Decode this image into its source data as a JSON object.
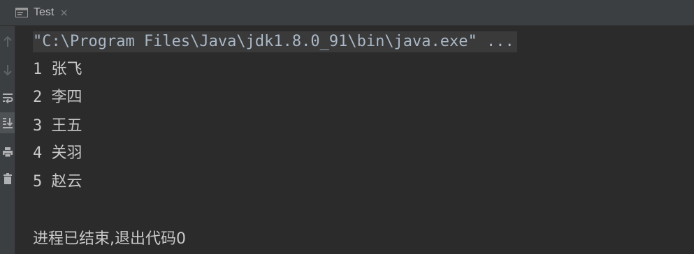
{
  "tab": {
    "title": "Test",
    "icon": "console-icon",
    "close": "×"
  },
  "toolbar": {
    "buttons": [
      {
        "name": "up-arrow-icon",
        "label": "↑"
      },
      {
        "name": "down-arrow-icon",
        "label": "↓"
      },
      {
        "name": "soft-wrap-icon",
        "label": "wrap"
      },
      {
        "name": "scroll-to-end-icon",
        "label": "scroll-end"
      },
      {
        "name": "print-icon",
        "label": "print"
      },
      {
        "name": "trash-icon",
        "label": "clear"
      }
    ]
  },
  "console": {
    "command": "\"C:\\Program Files\\Java\\jdk1.8.0_91\\bin\\java.exe\" ...",
    "output": [
      {
        "num": "1",
        "text": "张飞"
      },
      {
        "num": "2",
        "text": "李四"
      },
      {
        "num": "3",
        "text": "王五"
      },
      {
        "num": "4",
        "text": "关羽"
      },
      {
        "num": "5",
        "text": "赵云"
      }
    ],
    "exit_message": "进程已结束,退出代码0"
  },
  "colors": {
    "background": "#2b2b2b",
    "toolbar": "#3c3f41",
    "text": "#c9c9c9",
    "command_highlight": "#3a3a3a"
  }
}
